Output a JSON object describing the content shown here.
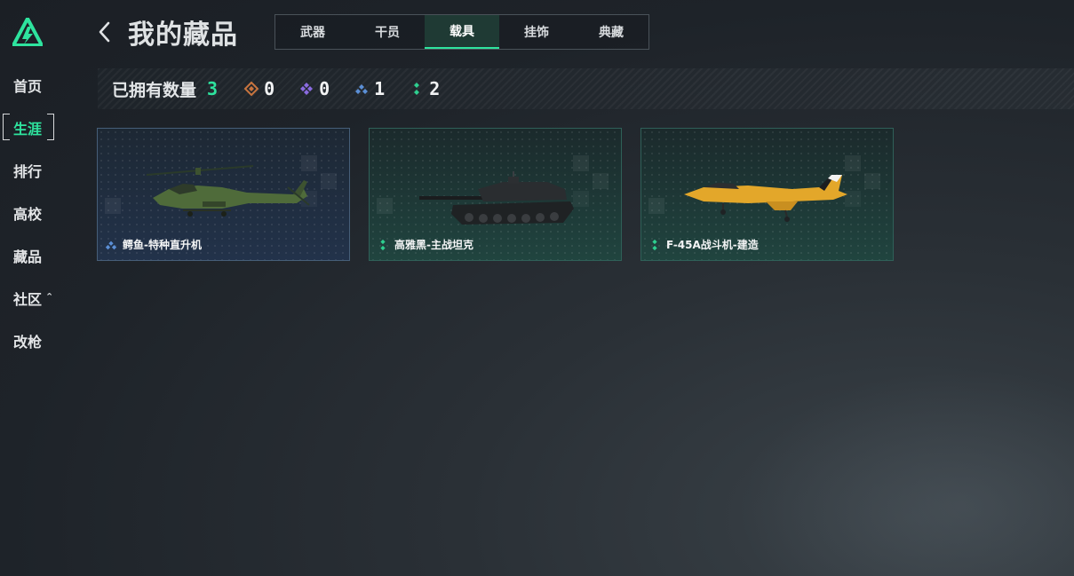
{
  "sidebar": {
    "items": [
      {
        "label": "首页"
      },
      {
        "label": "生涯"
      },
      {
        "label": "排行"
      },
      {
        "label": "高校"
      },
      {
        "label": "藏品"
      },
      {
        "label": "社区"
      },
      {
        "label": "改枪"
      }
    ],
    "active_index": 1
  },
  "header": {
    "title": "我的藏品",
    "tabs": [
      {
        "label": "武器"
      },
      {
        "label": "干员"
      },
      {
        "label": "载具"
      },
      {
        "label": "挂饰"
      },
      {
        "label": "典藏"
      }
    ],
    "active_tab_index": 2
  },
  "owned": {
    "label": "已拥有数量",
    "total": "3",
    "stats": [
      {
        "icon": "orange-diamond-icon",
        "value": "0",
        "color": "#c8743e"
      },
      {
        "icon": "purple-diamond-icon",
        "value": "0",
        "color": "#8a6be0"
      },
      {
        "icon": "blue-triad-icon",
        "value": "1",
        "color": "#5b8fd6"
      },
      {
        "icon": "green-dots-icon",
        "value": "2",
        "color": "#2ecf8f"
      }
    ]
  },
  "cards": [
    {
      "name": "鳄鱼-特种直升机",
      "rarity": "blue",
      "art": "helicopter"
    },
    {
      "name": "高雅黑-主战坦克",
      "rarity": "green",
      "art": "tank"
    },
    {
      "name": "F-45A战斗机-建造",
      "rarity": "green",
      "art": "jet"
    }
  ],
  "colors": {
    "accent": "#2ee39e"
  }
}
